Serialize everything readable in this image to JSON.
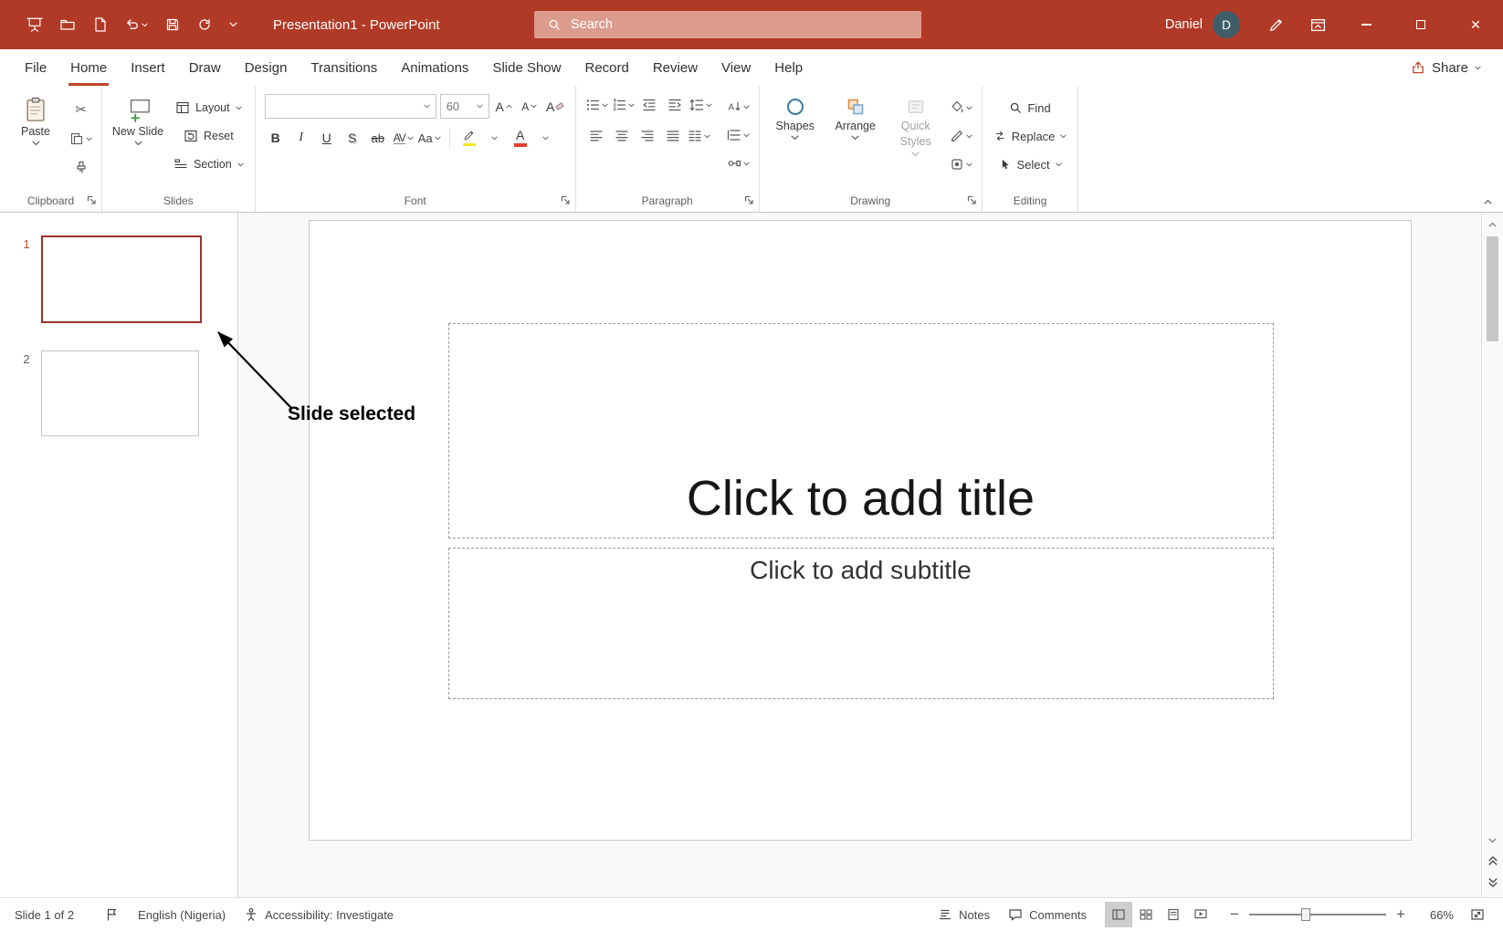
{
  "colors": {
    "titlebar_red": "#B13A27",
    "accent_red": "#C0452A",
    "selected_slide_border": "#99342A",
    "avatar_bg": "#3F5D68",
    "font_color_red": "#E03E2D",
    "highlight_yellow": "#F6E71C"
  },
  "titlebar": {
    "title": "Presentation1 - PowerPoint",
    "search_placeholder": "Search",
    "user_name": "Daniel",
    "user_initial": "D"
  },
  "tabs": {
    "items": [
      "File",
      "Home",
      "Insert",
      "Draw",
      "Design",
      "Transitions",
      "Animations",
      "Slide Show",
      "Record",
      "Review",
      "View",
      "Help"
    ],
    "active": "Home",
    "share": "Share"
  },
  "ribbon": {
    "clipboard": {
      "label": "Clipboard",
      "paste": "Paste"
    },
    "slides": {
      "label": "Slides",
      "new_slide": "New Slide",
      "layout": "Layout",
      "reset": "Reset",
      "section": "Section"
    },
    "font": {
      "label": "Font",
      "font_name": "",
      "font_size": "60",
      "grow": "A",
      "shrink": "A",
      "clear": "A",
      "bold": "B",
      "italic": "I",
      "underline": "U",
      "shadow": "S",
      "strike": "ab",
      "kerning": "AV",
      "case": "Aa",
      "color": "A"
    },
    "paragraph": {
      "label": "Paragraph"
    },
    "drawing": {
      "label": "Drawing",
      "shapes": "Shapes",
      "arrange": "Arrange",
      "quick_styles_1": "Quick",
      "quick_styles_2": "Styles"
    },
    "editing": {
      "label": "Editing",
      "find": "Find",
      "replace": "Replace",
      "select": "Select"
    }
  },
  "slide_panel": {
    "slides": [
      {
        "number": "1",
        "selected": true
      },
      {
        "number": "2",
        "selected": false
      }
    ]
  },
  "annotation": {
    "label": "Slide selected"
  },
  "slide": {
    "title_placeholder": "Click to add title",
    "subtitle_placeholder": "Click to add subtitle"
  },
  "statusbar": {
    "slide_indicator": "Slide 1 of 2",
    "language": "English (Nigeria)",
    "accessibility": "Accessibility: Investigate",
    "notes": "Notes",
    "comments": "Comments",
    "zoom": "66%"
  }
}
